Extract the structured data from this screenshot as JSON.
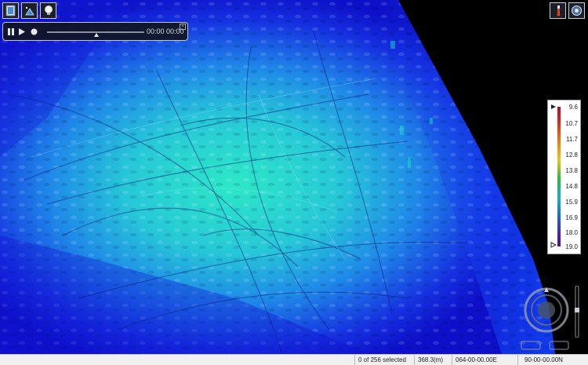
{
  "toolbar": {
    "left_icons": [
      "document-icon",
      "terrain-icon",
      "lightbulb-icon"
    ],
    "right_icons": [
      "thermometer-icon",
      "settings-icon"
    ]
  },
  "player": {
    "time": "00:00  00:00",
    "progress": 0.5
  },
  "legend": {
    "ticks": [
      "9.6",
      "10.7",
      "11.7",
      "12.8",
      "13.8",
      "14.8",
      "15.9",
      "16.9",
      "18.0",
      "19.0"
    ]
  },
  "status": {
    "selection": "0 of 256 selected",
    "depth": "368.3(m)",
    "longitude": "064-00-00.00E",
    "latitude": "90-00-00.00N"
  },
  "colors": {
    "deep": "#0f1ad8",
    "mid": "#2a7cf0",
    "shallow": "#1ce0c0"
  }
}
